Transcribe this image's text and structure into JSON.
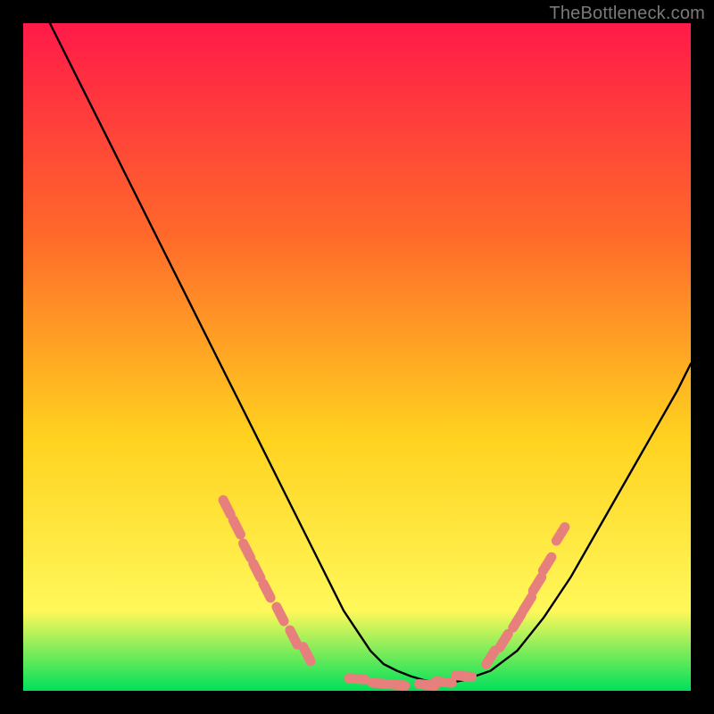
{
  "watermark": "TheBottleneck.com",
  "colors": {
    "gradient_top": "#ff1a49",
    "gradient_mid1": "#ff6a2a",
    "gradient_mid2": "#ffd21f",
    "gradient_mid3": "#fff85a",
    "gradient_bottom": "#00e05a",
    "curve": "#000000",
    "markers": "#e77f7c",
    "frame": "#000000"
  },
  "chart_data": {
    "type": "line",
    "title": "",
    "xlabel": "",
    "ylabel": "",
    "xlim": [
      0,
      100
    ],
    "ylim": [
      0,
      100
    ],
    "curve_x": [
      4,
      8,
      12,
      16,
      20,
      24,
      28,
      32,
      36,
      40,
      44,
      48,
      50,
      52,
      54,
      56,
      58,
      60,
      62,
      64,
      66,
      70,
      74,
      78,
      82,
      86,
      90,
      94,
      98,
      100
    ],
    "curve_y": [
      100,
      92,
      84,
      76,
      68,
      60,
      52,
      44,
      36,
      28,
      20,
      12,
      9,
      6,
      4,
      3,
      2.2,
      1.6,
      1.2,
      1.2,
      1.6,
      3,
      6,
      11,
      17,
      24,
      31,
      38,
      45,
      49
    ],
    "annotations": {
      "notch_markers_left": [
        {
          "x": 30.5,
          "y": 27.5
        },
        {
          "x": 32.0,
          "y": 24.5
        },
        {
          "x": 33.5,
          "y": 21.0
        },
        {
          "x": 35.0,
          "y": 18.0
        },
        {
          "x": 36.5,
          "y": 15.0
        },
        {
          "x": 38.5,
          "y": 11.5
        },
        {
          "x": 40.5,
          "y": 8.0
        },
        {
          "x": 42.5,
          "y": 5.5
        }
      ],
      "notch_markers_bottom": [
        {
          "x": 50.0,
          "y": 1.8
        },
        {
          "x": 53.5,
          "y": 1.1
        },
        {
          "x": 56.0,
          "y": 0.9
        },
        {
          "x": 60.5,
          "y": 0.9
        },
        {
          "x": 63.0,
          "y": 1.3
        },
        {
          "x": 66.0,
          "y": 2.2
        }
      ],
      "notch_markers_right": [
        {
          "x": 70.0,
          "y": 5.0
        },
        {
          "x": 72.0,
          "y": 7.5
        },
        {
          "x": 74.0,
          "y": 10.5
        },
        {
          "x": 75.5,
          "y": 13.0
        },
        {
          "x": 77.0,
          "y": 16.0
        },
        {
          "x": 78.5,
          "y": 19.0
        },
        {
          "x": 80.5,
          "y": 23.5
        }
      ]
    }
  }
}
